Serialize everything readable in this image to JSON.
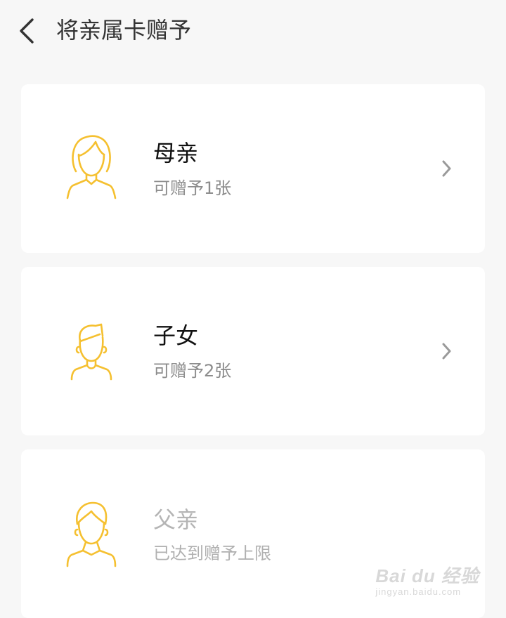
{
  "header": {
    "title": "将亲属卡赠予"
  },
  "relatives": [
    {
      "name": "母亲",
      "status": "可赠予1张",
      "enabled": true
    },
    {
      "name": "子女",
      "status": "可赠予2张",
      "enabled": true
    },
    {
      "name": "父亲",
      "status": "已达到赠予上限",
      "enabled": false
    }
  ],
  "watermark": {
    "main": "Bai du 经验",
    "sub": "jingyan.baidu.com"
  },
  "colors": {
    "accent": "#f5c030",
    "background": "#f7f7f7",
    "card": "#ffffff"
  },
  "icons": [
    "back-arrow-icon",
    "female-avatar-icon",
    "child-avatar-icon",
    "male-avatar-icon",
    "chevron-right-icon"
  ]
}
